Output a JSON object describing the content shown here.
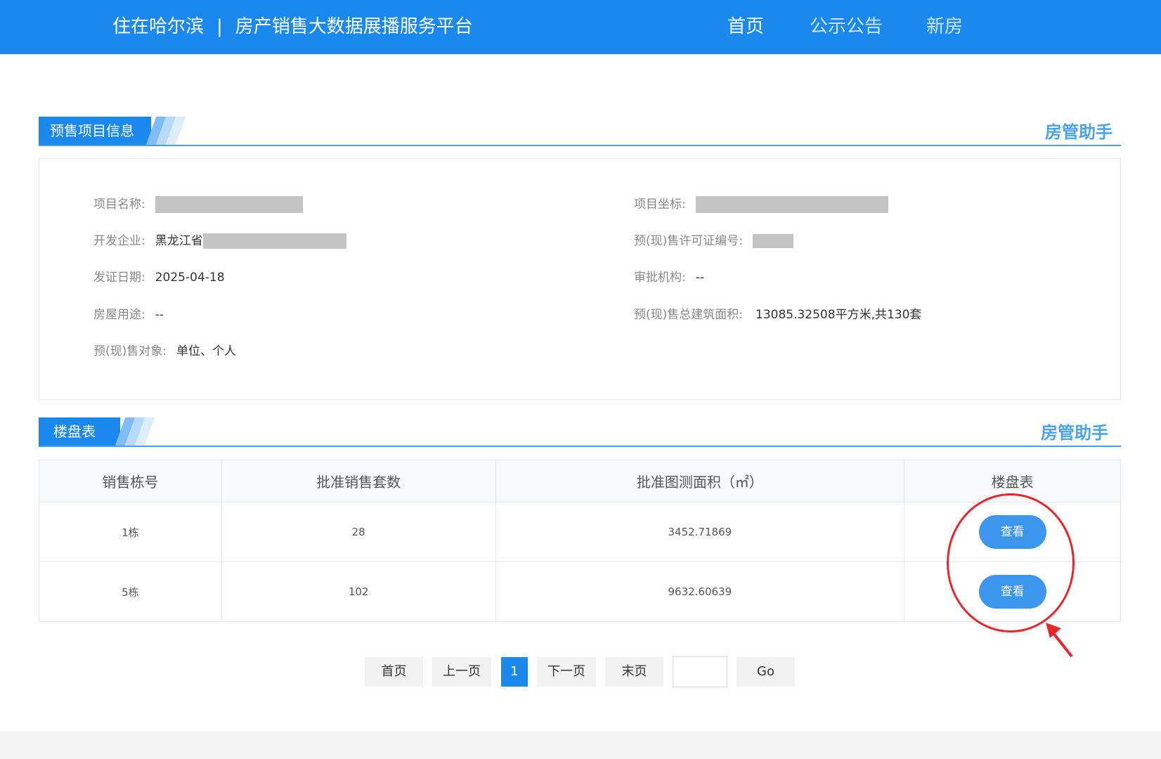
{
  "header": {
    "brand_city": "住在哈尔滨",
    "brand_sep": "|",
    "brand_platform": "房产销售大数据展播服务平台",
    "nav": {
      "home": "首页",
      "notice": "公示公告",
      "new_house": "新房"
    }
  },
  "presale": {
    "tag": "预售项目信息",
    "helper": "房管助手",
    "project_name_label": "项目名称:",
    "project_coord_label": "项目坐标:",
    "developer_label": "开发企业:",
    "developer_value": "黑龙江省",
    "license_label": "预(现)售许可证编号:",
    "issue_date_label": "发证日期:",
    "issue_date_value": "2025-04-18",
    "approval_label": "审批机构:",
    "approval_value": "--",
    "usage_label": "房屋用途:",
    "usage_value": "--",
    "total_area_label": "预(现)售总建筑面积:",
    "total_area_value": "13085.32508平方米,共130套",
    "target_label": "预(现)售对象:",
    "target_value": "单位、个人"
  },
  "buildings": {
    "tag": "楼盘表",
    "helper": "房管助手",
    "columns": [
      "销售栋号",
      "批准销售套数",
      "批准图测面积（㎡）",
      "楼盘表"
    ],
    "rows": [
      {
        "building": "1栋",
        "units": "28",
        "area": "3452.71869",
        "action": "查看"
      },
      {
        "building": "5栋",
        "units": "102",
        "area": "9632.60639",
        "action": "查看"
      }
    ]
  },
  "pager": {
    "first": "首页",
    "prev": "上一页",
    "current": "1",
    "next": "下一页",
    "last": "末页",
    "go": "Go"
  },
  "colors": {
    "primary": "#1a88ec",
    "helper_text": "#4aa3ef",
    "annotation": "#e8262b"
  }
}
